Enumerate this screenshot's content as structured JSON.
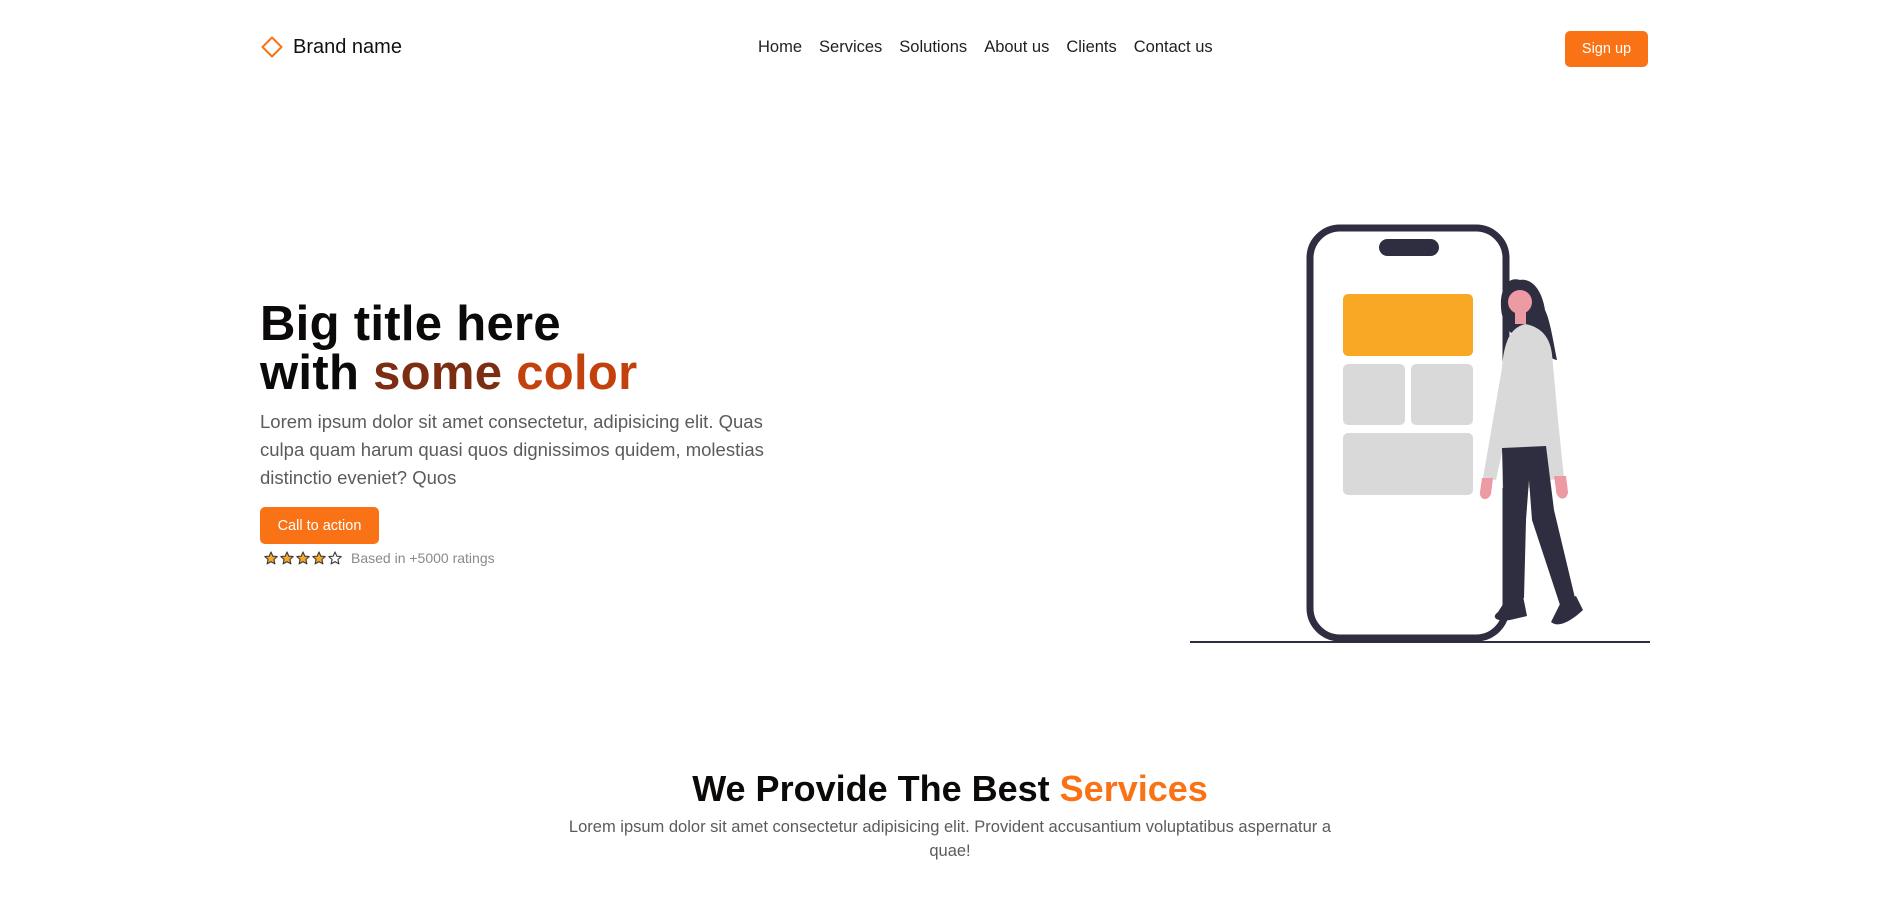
{
  "header": {
    "brand_name": "Brand name",
    "brand_icon": "diamond-outline-icon",
    "nav": [
      "Home",
      "Services",
      "Solutions",
      "About us",
      "Clients",
      "Contact us"
    ],
    "signup_label": "Sign up"
  },
  "hero": {
    "title_line1": "Big title here",
    "title_line2_plain": "with",
    "title_line2_accent1": "some",
    "title_line2_accent2": "color",
    "description": "Lorem ipsum dolor sit amet consectetur, adipisicing elit. Quas culpa quam harum quasi quos dignissimos quidem, molestias distinctio eveniet? Quos",
    "cta_label": "Call to action",
    "rating_stars": 4,
    "rating_max": 5,
    "rating_text": "Based in +5000 ratings",
    "illustration": "woman-standing-next-to-phone-illustration"
  },
  "services": {
    "title_plain": "We Provide The Best",
    "title_accent": "Services",
    "description": "Lorem ipsum dolor sit amet consectetur adipisicing elit. Provident accusantium voluptatibus aspernatur a quae!"
  },
  "colors": {
    "accent": "#f97316",
    "title_dark": "#0c0a09",
    "accent_brown": "#7c2d12",
    "accent_orange_dark": "#c2410c",
    "illustration_card": "#f9a826",
    "illustration_dark": "#2f2e41"
  }
}
